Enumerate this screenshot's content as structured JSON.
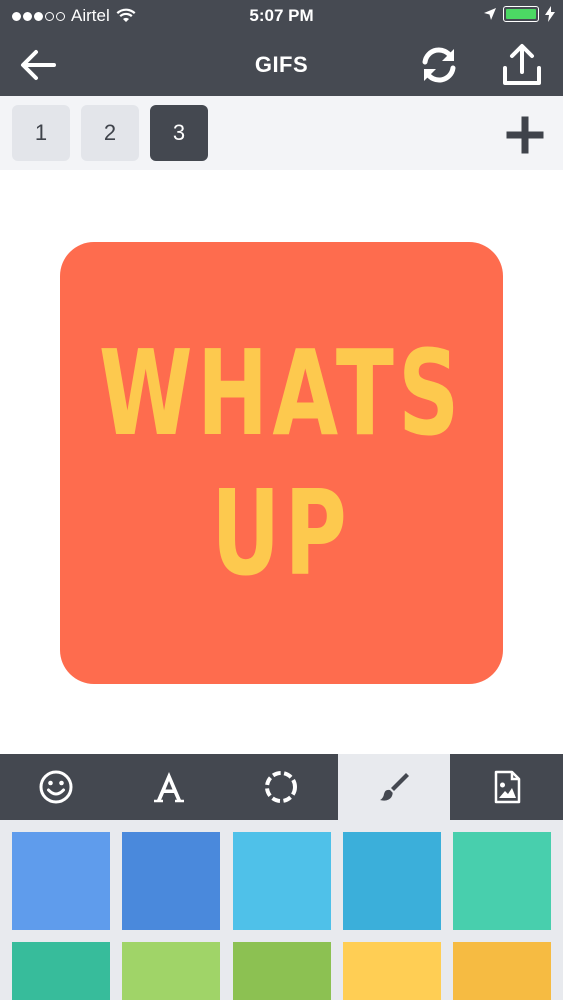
{
  "status_bar": {
    "carrier": "Airtel",
    "time": "5:07 PM",
    "signal_icon": "signal-dots-icon",
    "wifi_icon": "wifi-icon",
    "location_icon": "location-arrow-icon",
    "battery_icon": "battery-icon",
    "charging_icon": "charging-bolt-icon",
    "battery_level": 1.0,
    "battery_color": "#4cd964"
  },
  "header": {
    "title": "GIFS",
    "back_icon": "back-arrow-icon",
    "refresh_icon": "refresh-icon",
    "share_icon": "share-upload-icon",
    "background": "#464a52"
  },
  "frames": {
    "tabs": [
      {
        "label": "1",
        "active": false
      },
      {
        "label": "2",
        "active": false
      },
      {
        "label": "3",
        "active": true
      }
    ],
    "add_icon": "plus-icon"
  },
  "card": {
    "lines": [
      "WHATS",
      "UP"
    ],
    "background": "#fe6c4e",
    "text_color": "#fdc94e"
  },
  "tools": [
    {
      "name": "emoji",
      "icon": "smiley-icon",
      "active": false
    },
    {
      "name": "text",
      "icon": "text-font-icon",
      "active": false
    },
    {
      "name": "border",
      "icon": "dashed-circle-icon",
      "active": false
    },
    {
      "name": "color",
      "icon": "paintbrush-icon",
      "active": true
    },
    {
      "name": "image",
      "icon": "image-file-icon",
      "active": false
    }
  ],
  "swatches": [
    "#5f9cec",
    "#4a89dc",
    "#4fc1e9",
    "#3bafda",
    "#48cfad",
    "#37bc9b",
    "#a0d468",
    "#8cc152",
    "#ffce54",
    "#f6bb42"
  ]
}
